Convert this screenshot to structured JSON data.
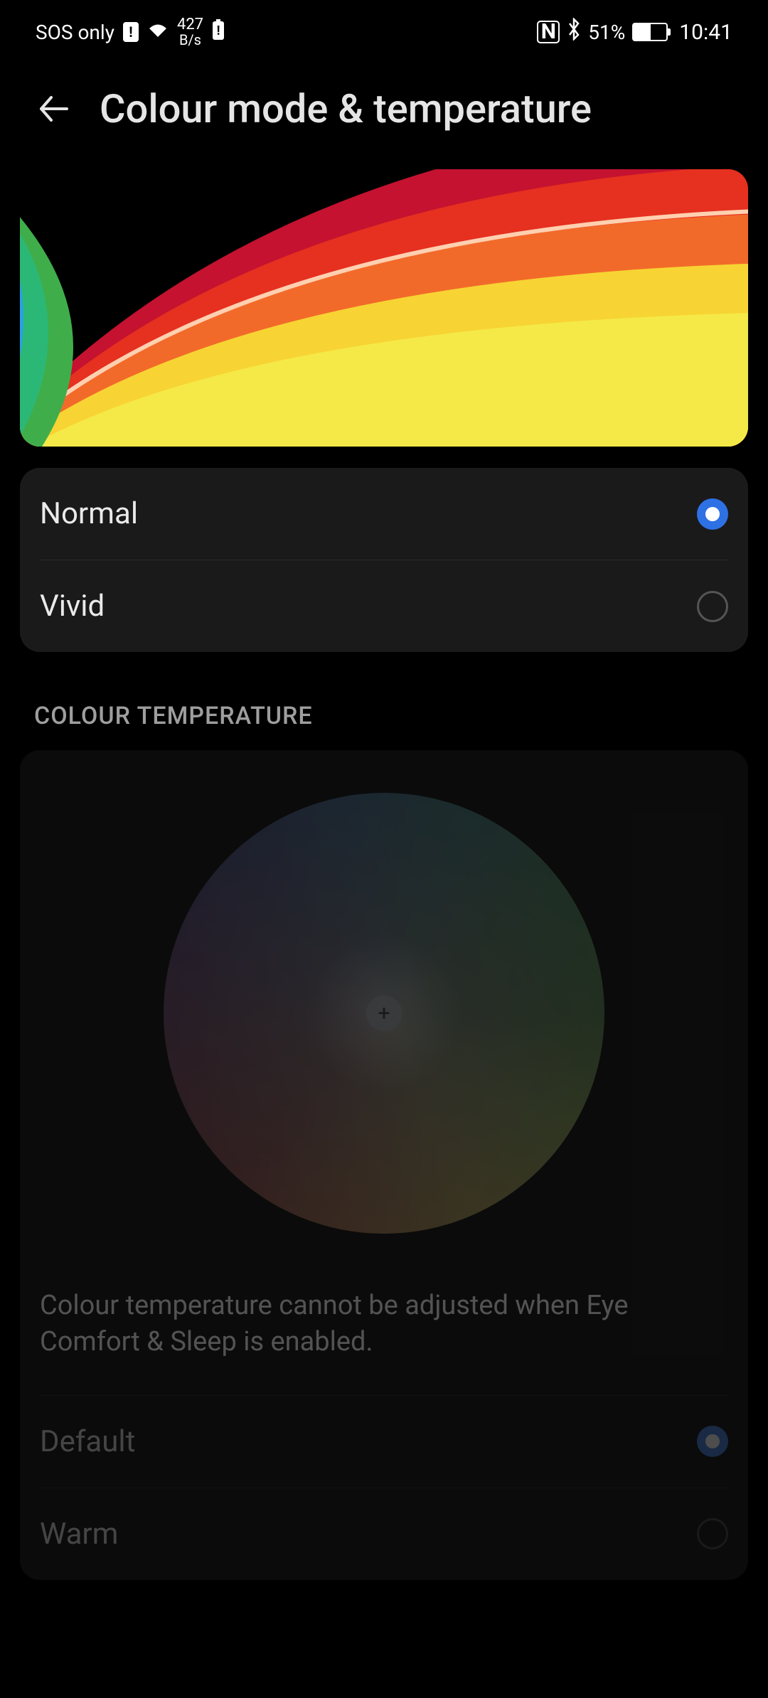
{
  "statusBar": {
    "network": "SOS only",
    "speedTop": "427",
    "speedBottom": "B/s",
    "batteryPercent": "51%",
    "time": "10:41"
  },
  "header": {
    "title": "Colour mode & temperature"
  },
  "modeOptions": [
    {
      "label": "Normal",
      "selected": true
    },
    {
      "label": "Vivid",
      "selected": false
    }
  ],
  "tempSection": {
    "header": "COLOUR TEMPERATURE",
    "info": "Colour temperature cannot be adjusted when Eye Comfort & Sleep is enabled.",
    "disabled": true,
    "options": [
      {
        "label": "Default",
        "selected": true
      },
      {
        "label": "Warm",
        "selected": false
      }
    ]
  }
}
